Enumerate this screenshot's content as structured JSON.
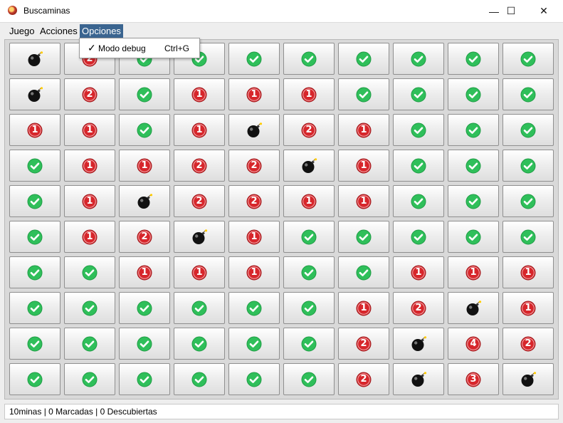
{
  "window": {
    "title": "Buscaminas",
    "minimize_glyph": "—",
    "maximize_glyph": "☐",
    "close_glyph": "✕"
  },
  "menubar": {
    "items": [
      "Juego",
      "Acciones",
      "Opciones"
    ],
    "active_index": 2
  },
  "dropdown": {
    "check": "✓",
    "label": "Modo debug",
    "shortcut": "Ctrl+G"
  },
  "board": {
    "rows": 10,
    "cols": 10,
    "cells": [
      [
        "mine",
        "2",
        "safe",
        "safe",
        "safe",
        "safe",
        "safe",
        "safe",
        "safe",
        "safe"
      ],
      [
        "mine",
        "2",
        "safe",
        "1",
        "1",
        "1",
        "safe",
        "safe",
        "safe",
        "safe"
      ],
      [
        "1",
        "1",
        "safe",
        "1",
        "mine",
        "2",
        "1",
        "safe",
        "safe",
        "safe"
      ],
      [
        "safe",
        "1",
        "1",
        "2",
        "2",
        "mine",
        "1",
        "safe",
        "safe",
        "safe"
      ],
      [
        "safe",
        "1",
        "mine",
        "2",
        "2",
        "1",
        "1",
        "safe",
        "safe",
        "safe"
      ],
      [
        "safe",
        "1",
        "2",
        "mine",
        "1",
        "safe",
        "safe",
        "safe",
        "safe",
        "safe"
      ],
      [
        "safe",
        "safe",
        "1",
        "1",
        "1",
        "safe",
        "safe",
        "1",
        "1",
        "1"
      ],
      [
        "safe",
        "safe",
        "safe",
        "safe",
        "safe",
        "safe",
        "1",
        "2",
        "mine",
        "1"
      ],
      [
        "safe",
        "safe",
        "safe",
        "safe",
        "safe",
        "safe",
        "2",
        "mine",
        "4",
        "2"
      ],
      [
        "safe",
        "safe",
        "safe",
        "safe",
        "safe",
        "safe",
        "2",
        "mine",
        "3",
        "mine"
      ]
    ]
  },
  "icons": {
    "safe": "check-circle-icon",
    "mine": "bomb-icon",
    "number": "number-badge-icon"
  },
  "colors": {
    "safe": "#2fbf5a",
    "number": "#d7262b",
    "mine": "#111111",
    "menu_active": "#3b6590"
  },
  "status": {
    "text": "10minas | 0 Marcadas | 0 Descubiertas"
  }
}
